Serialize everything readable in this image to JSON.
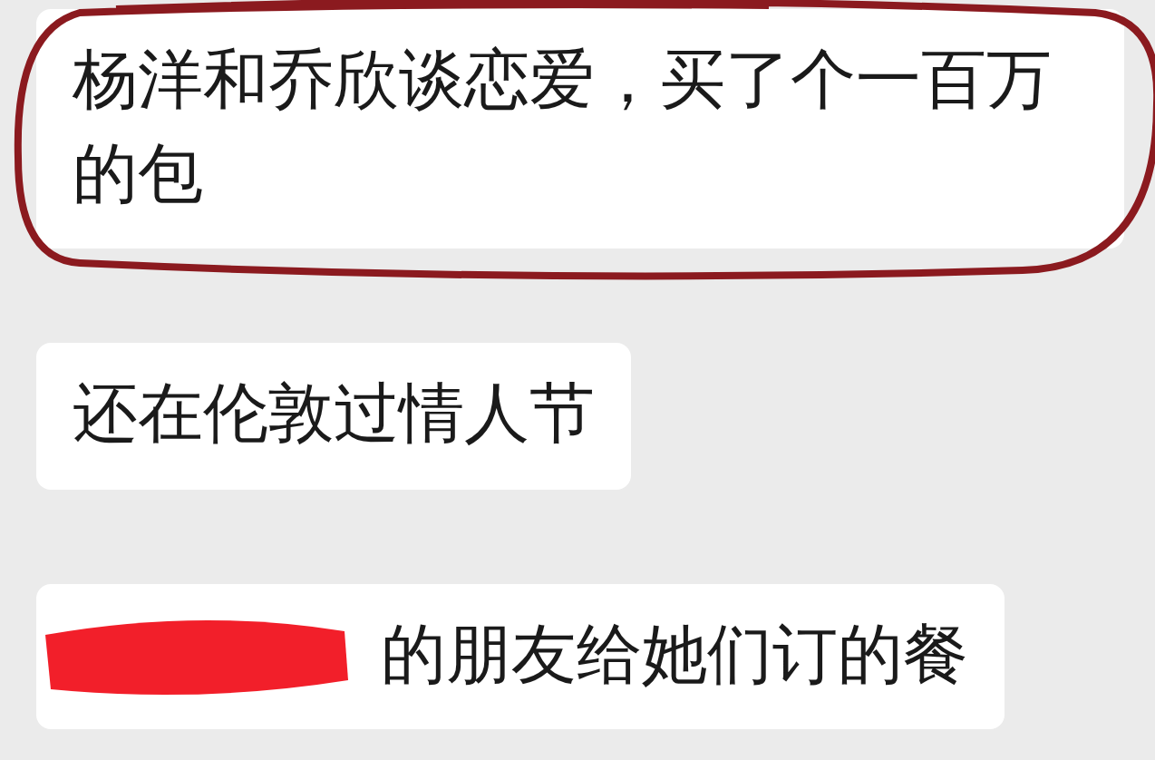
{
  "messages": [
    {
      "text": "杨洋和乔欣谈恋爱，买了个一百万的包",
      "circled": true,
      "redacted": false
    },
    {
      "text": "还在伦敦过情人节",
      "circled": false,
      "redacted": false
    },
    {
      "text": "的朋友给她们订的餐",
      "circled": false,
      "redacted": true
    }
  ]
}
